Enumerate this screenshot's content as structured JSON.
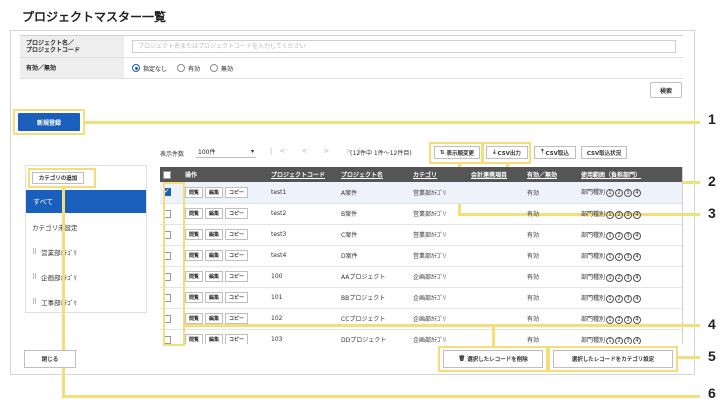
{
  "page_title": "プロジェクトマスター一覧",
  "search": {
    "name_label": "プロジェクト名／\nプロジェクトコード",
    "name_placeholder": "プロジェクト名またはプロジェクトコードを入力してください",
    "status_label": "有効／無効",
    "status_options": [
      "指定なし",
      "有効",
      "無効"
    ],
    "status_selected": "指定なし",
    "search_button": "検索"
  },
  "new_button": "新規登録",
  "sidebar": {
    "add_category_button": "カテゴリの追加",
    "all": "すべて",
    "unset": "カテゴリ未設定",
    "categories": [
      "営業部ｶﾃｺﾞﾘ",
      "企画部ｶﾃｺﾞﾘ",
      "工事部ｶﾃｺﾞﾘ"
    ]
  },
  "toolbar": {
    "per_page_label": "表示件数",
    "per_page_value": "100件",
    "pager_icons": "|< < > >|",
    "range_text": "(12件中 1件～12件目)",
    "order_change": "表示順変更",
    "csv_export": "CSV出力",
    "csv_import": "CSV取込",
    "csv_import_status": "CSV取込状況"
  },
  "table": {
    "headers": [
      "操作",
      "プロジェクトコード",
      "プロジェクト名",
      "カテゴリ",
      "会計連携項目",
      "有効／無効",
      "使用範囲（負担部門）"
    ],
    "row_buttons": [
      "閲覧",
      "編集",
      "コピー"
    ],
    "usage_prefix": "部門種別",
    "usage_numbers": [
      "1",
      "2",
      "3",
      "4"
    ],
    "rows": [
      {
        "code": "test1",
        "name": "A案件",
        "category": "営業部ｶﾃｺﾞﾘ",
        "status": "有効",
        "checked": true
      },
      {
        "code": "test2",
        "name": "B案件",
        "category": "営業部ｶﾃｺﾞﾘ",
        "status": "有効",
        "checked": false
      },
      {
        "code": "test3",
        "name": "C案件",
        "category": "営業部ｶﾃｺﾞﾘ",
        "status": "有効",
        "checked": false
      },
      {
        "code": "test4",
        "name": "D案件",
        "category": "営業部ｶﾃｺﾞﾘ",
        "status": "有効",
        "checked": false
      },
      {
        "code": "100",
        "name": "AAプロジェクト",
        "category": "企画部ｶﾃｺﾞﾘ",
        "status": "有効",
        "checked": false
      },
      {
        "code": "101",
        "name": "BBプロジェクト",
        "category": "企画部ｶﾃｺﾞﾘ",
        "status": "有効",
        "checked": false
      },
      {
        "code": "102",
        "name": "CCプロジェクト",
        "category": "企画部ｶﾃｺﾞﾘ",
        "status": "有効",
        "checked": false
      },
      {
        "code": "103",
        "name": "DDプロジェクト",
        "category": "企画部ｶﾃｺﾞﾘ",
        "status": "有効",
        "checked": false
      }
    ]
  },
  "bottom": {
    "close_button": "閉じる",
    "delete_button": "選択したレコードを削除",
    "set_category_button": "選択したレコードをカテゴリ設定"
  },
  "callouts": [
    "1",
    "2",
    "3",
    "4",
    "5",
    "6"
  ],
  "colors": {
    "accent": "#1b5fbd",
    "highlight": "#f5de7a",
    "header_bg": "#555555"
  }
}
